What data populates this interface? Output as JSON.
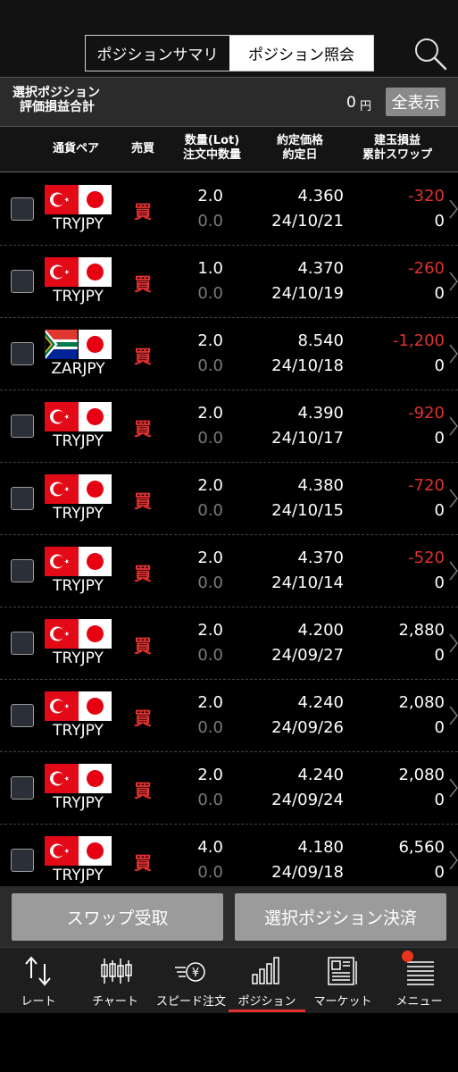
{
  "header": {
    "tabs": [
      {
        "label": "ポジションサマリ",
        "active": false
      },
      {
        "label": "ポジション照会",
        "active": true
      }
    ],
    "search_icon": "search-icon"
  },
  "summary": {
    "label_line1": "選択ポジション",
    "label_line2": "評価損益合計",
    "value": "0",
    "unit": "円",
    "show_all_label": "全表示"
  },
  "columns": {
    "pair": "通貨ペア",
    "side": "売買",
    "qty_line1": "数量(Lot)",
    "qty_line2": "注文中数量",
    "price_line1": "約定価格",
    "price_line2": "約定日",
    "pl_line1": "建玉損益",
    "pl_line2": "累計スワップ"
  },
  "positions": [
    {
      "pair": "TRYJPY",
      "flag": "TRY",
      "side": "買",
      "qty": "2.0",
      "ordering": "0.0",
      "price": "4.360",
      "date": "24/10/21",
      "pl": "-320",
      "swap": "0",
      "negative": true
    },
    {
      "pair": "TRYJPY",
      "flag": "TRY",
      "side": "買",
      "qty": "1.0",
      "ordering": "0.0",
      "price": "4.370",
      "date": "24/10/19",
      "pl": "-260",
      "swap": "0",
      "negative": true
    },
    {
      "pair": "ZARJPY",
      "flag": "ZAR",
      "side": "買",
      "qty": "2.0",
      "ordering": "0.0",
      "price": "8.540",
      "date": "24/10/18",
      "pl": "-1,200",
      "swap": "0",
      "negative": true
    },
    {
      "pair": "TRYJPY",
      "flag": "TRY",
      "side": "買",
      "qty": "2.0",
      "ordering": "0.0",
      "price": "4.390",
      "date": "24/10/17",
      "pl": "-920",
      "swap": "0",
      "negative": true
    },
    {
      "pair": "TRYJPY",
      "flag": "TRY",
      "side": "買",
      "qty": "2.0",
      "ordering": "0.0",
      "price": "4.380",
      "date": "24/10/15",
      "pl": "-720",
      "swap": "0",
      "negative": true
    },
    {
      "pair": "TRYJPY",
      "flag": "TRY",
      "side": "買",
      "qty": "2.0",
      "ordering": "0.0",
      "price": "4.370",
      "date": "24/10/14",
      "pl": "-520",
      "swap": "0",
      "negative": true
    },
    {
      "pair": "TRYJPY",
      "flag": "TRY",
      "side": "買",
      "qty": "2.0",
      "ordering": "0.0",
      "price": "4.200",
      "date": "24/09/27",
      "pl": "2,880",
      "swap": "0",
      "negative": false
    },
    {
      "pair": "TRYJPY",
      "flag": "TRY",
      "side": "買",
      "qty": "2.0",
      "ordering": "0.0",
      "price": "4.240",
      "date": "24/09/26",
      "pl": "2,080",
      "swap": "0",
      "negative": false
    },
    {
      "pair": "TRYJPY",
      "flag": "TRY",
      "side": "買",
      "qty": "2.0",
      "ordering": "0.0",
      "price": "4.240",
      "date": "24/09/24",
      "pl": "2,080",
      "swap": "0",
      "negative": false
    },
    {
      "pair": "TRYJPY",
      "flag": "TRY",
      "side": "買",
      "qty": "4.0",
      "ordering": "0.0",
      "price": "4.180",
      "date": "24/09/18",
      "pl": "6,560",
      "swap": "0",
      "negative": false
    }
  ],
  "actions": {
    "swap_receive": "スワップ受取",
    "settle_selected": "選択ポジション決済"
  },
  "nav": [
    {
      "label": "レート",
      "icon": "rate-arrows-icon",
      "active": false
    },
    {
      "label": "チャート",
      "icon": "candlestick-icon",
      "active": false
    },
    {
      "label": "スピード注文",
      "icon": "speed-order-yen-icon",
      "active": false
    },
    {
      "label": "ポジション",
      "icon": "bar-chart-icon",
      "active": true
    },
    {
      "label": "マーケット",
      "icon": "newspaper-icon",
      "active": false
    },
    {
      "label": "メニュー",
      "icon": "menu-list-icon",
      "active": false
    }
  ],
  "colors": {
    "negative": "#e23030",
    "side_buy": "#e23030",
    "active_underline": "#e23030",
    "notification_badge": "#e8331f"
  }
}
